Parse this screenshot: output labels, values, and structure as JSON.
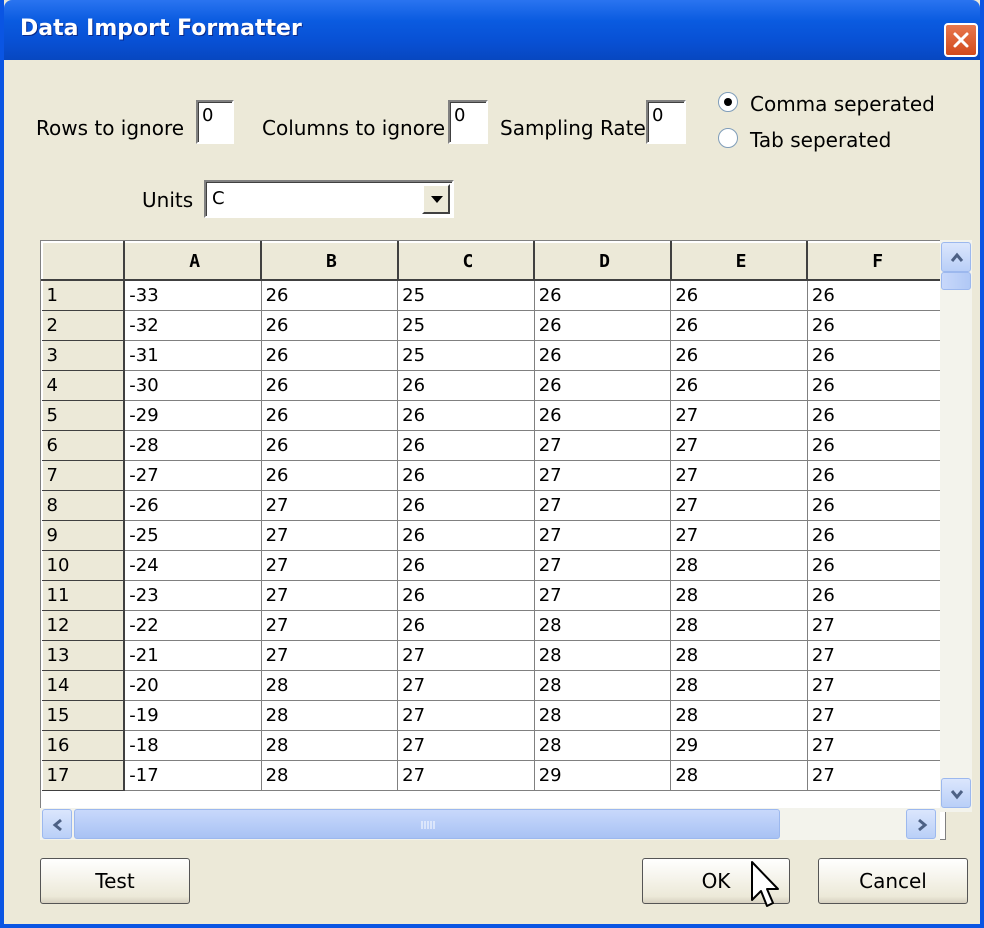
{
  "window": {
    "title": "Data Import Formatter"
  },
  "options": {
    "rows_to_ignore_label": "Rows to ignore",
    "rows_to_ignore_value": "0",
    "columns_to_ignore_label": "Columns to ignore",
    "columns_to_ignore_value": "0",
    "sampling_rate_label": "Sampling Rate",
    "sampling_rate_value": "0",
    "separator": {
      "comma_label": "Comma seperated",
      "tab_label": "Tab seperated",
      "selected": "comma"
    },
    "units_label": "Units",
    "units_value": "C"
  },
  "grid": {
    "columns": [
      "A",
      "B",
      "C",
      "D",
      "E",
      "F"
    ],
    "rows": [
      {
        "n": "1",
        "cells": [
          "-33",
          "26",
          "25",
          "26",
          "26",
          "26"
        ]
      },
      {
        "n": "2",
        "cells": [
          "-32",
          "26",
          "25",
          "26",
          "26",
          "26"
        ]
      },
      {
        "n": "3",
        "cells": [
          "-31",
          "26",
          "25",
          "26",
          "26",
          "26"
        ]
      },
      {
        "n": "4",
        "cells": [
          "-30",
          "26",
          "26",
          "26",
          "26",
          "26"
        ]
      },
      {
        "n": "5",
        "cells": [
          "-29",
          "26",
          "26",
          "26",
          "27",
          "26"
        ]
      },
      {
        "n": "6",
        "cells": [
          "-28",
          "26",
          "26",
          "27",
          "27",
          "26"
        ]
      },
      {
        "n": "7",
        "cells": [
          "-27",
          "26",
          "26",
          "27",
          "27",
          "26"
        ]
      },
      {
        "n": "8",
        "cells": [
          "-26",
          "27",
          "26",
          "27",
          "27",
          "26"
        ]
      },
      {
        "n": "9",
        "cells": [
          "-25",
          "27",
          "26",
          "27",
          "27",
          "26"
        ]
      },
      {
        "n": "10",
        "cells": [
          "-24",
          "27",
          "26",
          "27",
          "28",
          "26"
        ]
      },
      {
        "n": "11",
        "cells": [
          "-23",
          "27",
          "26",
          "27",
          "28",
          "26"
        ]
      },
      {
        "n": "12",
        "cells": [
          "-22",
          "27",
          "26",
          "28",
          "28",
          "27"
        ]
      },
      {
        "n": "13",
        "cells": [
          "-21",
          "27",
          "27",
          "28",
          "28",
          "27"
        ]
      },
      {
        "n": "14",
        "cells": [
          "-20",
          "28",
          "27",
          "28",
          "28",
          "27"
        ]
      },
      {
        "n": "15",
        "cells": [
          "-19",
          "28",
          "27",
          "28",
          "28",
          "27"
        ]
      },
      {
        "n": "16",
        "cells": [
          "-18",
          "28",
          "27",
          "28",
          "29",
          "27"
        ]
      },
      {
        "n": "17",
        "cells": [
          "-17",
          "28",
          "27",
          "29",
          "28",
          "27"
        ]
      }
    ]
  },
  "buttons": {
    "test": "Test",
    "ok": "OK",
    "cancel": "Cancel"
  },
  "icons": {
    "close": "close-icon",
    "combo_arrow": "chevron-down-icon",
    "scroll_up": "arrow-up-icon",
    "scroll_down": "arrow-down-icon",
    "scroll_left": "arrow-left-icon",
    "scroll_right": "arrow-right-icon",
    "cursor": "mouse-pointer-icon"
  }
}
